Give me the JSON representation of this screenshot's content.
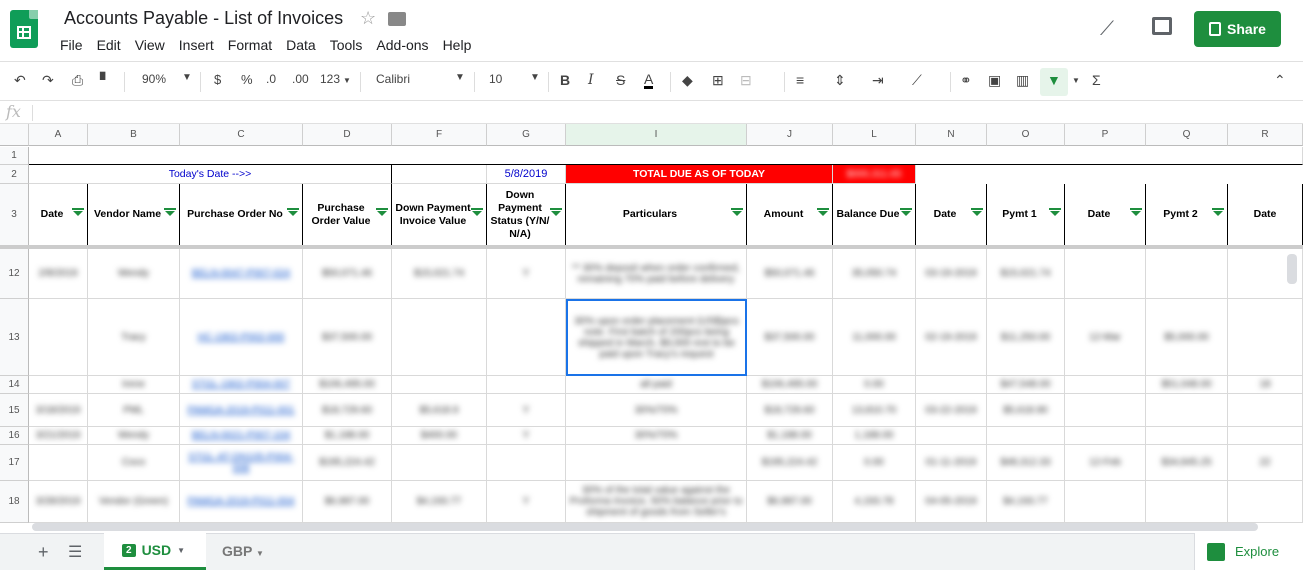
{
  "doc": {
    "title": "Accounts Payable - List of Invoices",
    "share_label": "Share"
  },
  "menu": [
    "File",
    "Edit",
    "View",
    "Insert",
    "Format",
    "Data",
    "Tools",
    "Add-ons",
    "Help"
  ],
  "toolbar": {
    "zoom": "90%",
    "currency": "$",
    "percent": "%",
    "dec_less": ".0",
    "dec_more": ".00",
    "more_formats": "123",
    "font": "Calibri",
    "font_size": "10"
  },
  "formula_bar": {
    "fx": "fx",
    "value": ""
  },
  "columns": [
    "A",
    "B",
    "C",
    "D",
    "F",
    "G",
    "I",
    "J",
    "L",
    "N",
    "O",
    "P",
    "Q",
    "R"
  ],
  "row_numbers": [
    "1",
    "2",
    "3",
    "12",
    "13",
    "14",
    "15",
    "16",
    "17",
    "18"
  ],
  "row2": {
    "todays_date_label": "Today's Date -->>",
    "todays_date": "5/8/2019",
    "total_due_label": "TOTAL DUE AS OF TODAY",
    "total_due_value": "$000,311.65"
  },
  "headers": [
    "Date",
    "Vendor Name",
    "Purchase Order No",
    "Purchase Order Value",
    "Down Payment Invoice Value",
    "Down Payment Status (Y/N/ N/A)",
    "Particulars",
    "Amount",
    "Balance Due",
    "Date",
    "Pymt 1",
    "Date",
    "Pymt 2",
    "Date"
  ],
  "rows": [
    [
      "2/8/2019",
      "Wendy",
      "BELN-0047-P007-024",
      "$50,071.46",
      "$15,021.74",
      "Y",
      "** 30% deposit when order confirmed, remaining 70% paid before delivery",
      "$50,071.46",
      "35,050.74",
      "03-19-2019",
      "$15,021.74",
      "",
      "",
      ""
    ],
    [
      "",
      "Tracy",
      "HC-1902-P002-000",
      "$37,500.00",
      "",
      "",
      "30% upon order placement (US$)pcs note. First batch of 200pcs being shipped in March, $9,000 rest to be paid upon Tracy's request",
      "$37,500.00",
      "11,000.00",
      "02-19-2019",
      "$11,250.00",
      "12-Mar",
      "$5,000.00",
      ""
    ],
    [
      "",
      "Irene",
      "STGL-1902-P004-007",
      "$106,495.00",
      "",
      "",
      "all paid",
      "$106,495.00",
      "0.00",
      "",
      "$47,548.00",
      "",
      "$51,048.00",
      "18"
    ],
    [
      "3/18/2019",
      "PML",
      "PAMGA-2019-P011-001",
      "$18,729.60",
      "$5,618.9",
      "Y",
      "30%/70%",
      "$18,729.60",
      "13,810.70",
      "03-22-2019",
      "$5,618.90",
      "",
      "",
      ""
    ],
    [
      "3/21/2019",
      "Wendy",
      "BELN-0021-P007-104",
      "$1,188.00",
      "$400.00",
      "Y",
      "30%/70%",
      "$1,188.00",
      "1,188.00",
      "",
      "",
      "",
      "",
      ""
    ],
    [
      "",
      "Coco",
      "STGL-AT-DN105-P004-008",
      "$195,224.42",
      "",
      "",
      "",
      "$195,224.42",
      "0.00",
      "01-11-2019",
      "$48,312.33",
      "12-Feb",
      "$34,845.25",
      "22"
    ],
    [
      "3/28/2019",
      "Vendor (Green)",
      "PAMGA-2019-P011-004",
      "$6,987.00",
      "$4,193.77",
      "Y",
      "30% of the total value against the Proforma Invoice, 50% balance prior to shipment of goods from Seller's",
      "$6,987.00",
      "4,193.78",
      "04-05-2019",
      "$4,193.77",
      "",
      "",
      ""
    ]
  ],
  "sheets": [
    {
      "num": "2",
      "name": "USD"
    },
    {
      "name": "GBP"
    }
  ],
  "explore_label": "Explore",
  "colors": {
    "brand": "#0f9d58",
    "share": "#1e8e3e",
    "total_due_bg": "#ff0000",
    "date_text": "#0000cc"
  }
}
